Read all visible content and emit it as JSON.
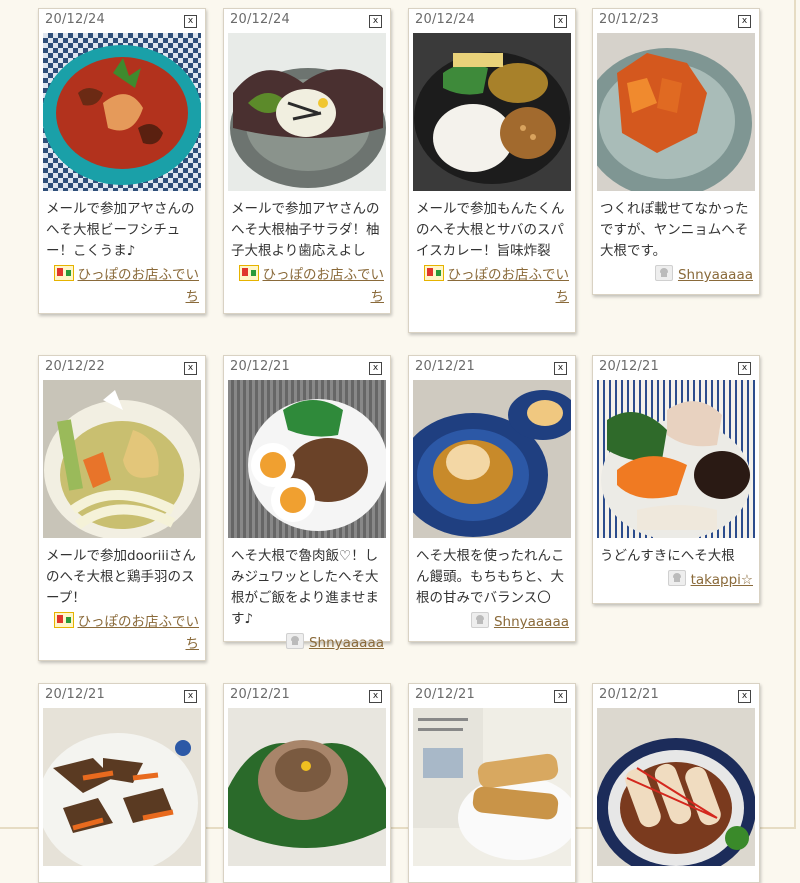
{
  "cards": [
    {
      "date": "20/12/24",
      "caption": "メールで参加アヤさんのへそ大根ビーフシチュー！こくうま♪",
      "author": "ひっぽのお店ふでいち",
      "author_type": "shop",
      "photo": "beef-stew"
    },
    {
      "date": "20/12/24",
      "caption": "メールで参加アヤさんのへそ大根柚子サラダ！柚子大根より歯応えよし",
      "author": "ひっぽのお店ふでいち",
      "author_type": "shop",
      "photo": "yuzu-salad"
    },
    {
      "date": "20/12/24",
      "caption": "メールで参加もんたくんのへそ大根とサバのスパイスカレー！旨味炸裂",
      "author": "ひっぽのお店ふでいち",
      "author_type": "shop",
      "photo": "spice-curry"
    },
    {
      "date": "20/12/23",
      "caption": "つくれぽ載せてなかったですが、ヤンニョムへそ大根です。",
      "author": "Shnyaaaaa",
      "author_type": "user",
      "photo": "yangnyeom"
    },
    {
      "date": "20/12/22",
      "caption": "メールで参加dooriiiさんのへそ大根と鶏手羽のスープ！",
      "author": "ひっぽのお店ふでいち",
      "author_type": "shop",
      "photo": "chicken-soup"
    },
    {
      "date": "20/12/21",
      "caption": "へそ大根で魯肉飯♡！しみジュワッとしたへそ大根がご飯をより進ませます♪",
      "author": "Shnyaaaaa",
      "author_type": "user",
      "photo": "lurou"
    },
    {
      "date": "20/12/21",
      "caption": "へそ大根を使ったれんこん饅頭。もちもちと、大根の甘みでバランス〇",
      "author": "Shnyaaaaa",
      "author_type": "user",
      "photo": "renkon"
    },
    {
      "date": "20/12/21",
      "caption": "うどんすきにへそ大根",
      "author": "takappi☆",
      "author_type": "user",
      "photo": "udonsuki"
    },
    {
      "date": "20/12/21",
      "caption": "",
      "author": "",
      "author_type": "",
      "photo": "kinpira"
    },
    {
      "date": "20/12/21",
      "caption": "",
      "author": "",
      "author_type": "",
      "photo": "stuffed"
    },
    {
      "date": "20/12/21",
      "caption": "",
      "author": "",
      "author_type": "",
      "photo": "spring-roll"
    },
    {
      "date": "20/12/21",
      "caption": "",
      "author": "",
      "author_type": "",
      "photo": "rolls"
    }
  ],
  "ui": {
    "close_glyph": "x"
  }
}
